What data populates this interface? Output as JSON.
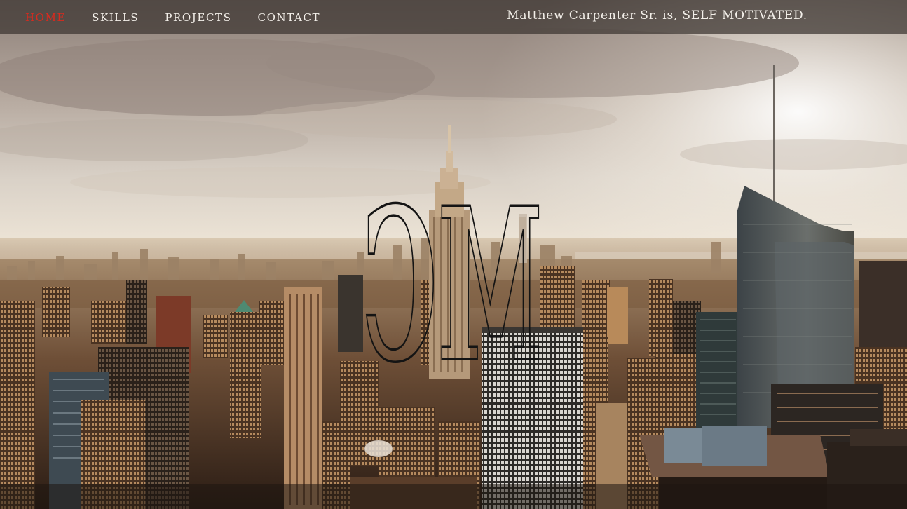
{
  "nav": {
    "items": [
      {
        "label": "HOME",
        "active": true
      },
      {
        "label": "SKILLS",
        "active": false
      },
      {
        "label": "PROJECTS",
        "active": false
      },
      {
        "label": "CONTACT",
        "active": false
      }
    ],
    "active_color": "#d82a1e",
    "text_color": "#f3efe9"
  },
  "header": {
    "name": "Matthew Carpenter Sr.",
    "verb": "is,",
    "trait": "SELF MOTIVATED."
  },
  "hero": {
    "monogram": "MC",
    "background_icon": "city-skyline-image"
  }
}
